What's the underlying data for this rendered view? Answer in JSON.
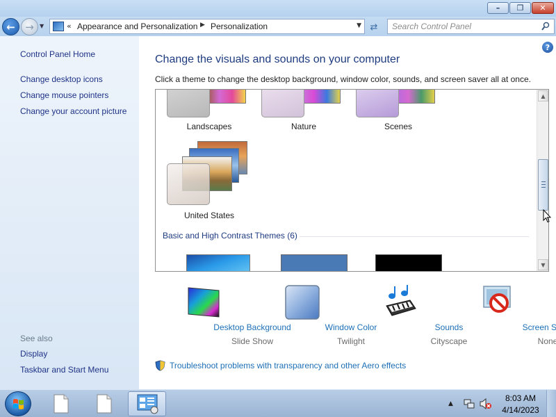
{
  "window": {
    "buttons": {
      "minimize": "–",
      "maximize": "❐",
      "close": "✕"
    }
  },
  "address_bar": {
    "chevron": "«",
    "crumbs": [
      "Appearance and Personalization",
      "Personalization"
    ],
    "separator": "▶",
    "dropdown": "▼"
  },
  "search": {
    "placeholder": "Search Control Panel"
  },
  "sidebar": {
    "home_link": "Control Panel Home",
    "links": [
      "Change desktop icons",
      "Change mouse pointers",
      "Change your account picture"
    ],
    "see_also_heading": "See also",
    "see_also_links": [
      "Display",
      "Taskbar and Start Menu"
    ]
  },
  "main": {
    "title": "Change the visuals and sounds on your computer",
    "subtitle": "Click a theme to change the desktop background, window color, sounds, and screen saver all at once.",
    "themes": [
      "Landscapes",
      "Nature",
      "Scenes",
      "United States"
    ],
    "basic_section_heading": "Basic and High Contrast Themes (6)",
    "settings": [
      {
        "label": "Desktop Background",
        "value": "Slide Show",
        "icon": "desktop-background-icon"
      },
      {
        "label": "Window Color",
        "value": "Twilight",
        "icon": "window-color-icon"
      },
      {
        "label": "Sounds",
        "value": "Cityscape",
        "icon": "sounds-icon"
      },
      {
        "label": "Screen Saver",
        "value": "None",
        "icon": "screen-saver-icon"
      }
    ],
    "troubleshoot_link": "Troubleshoot problems with transparency and other Aero effects",
    "help": "?"
  },
  "taskbar": {
    "time": "8:03 AM",
    "date": "4/14/2023",
    "tray_expand": "▲"
  },
  "colors": {
    "link": "#1c6fb7",
    "nav_link": "#1e3287",
    "title": "#1e3b80"
  }
}
